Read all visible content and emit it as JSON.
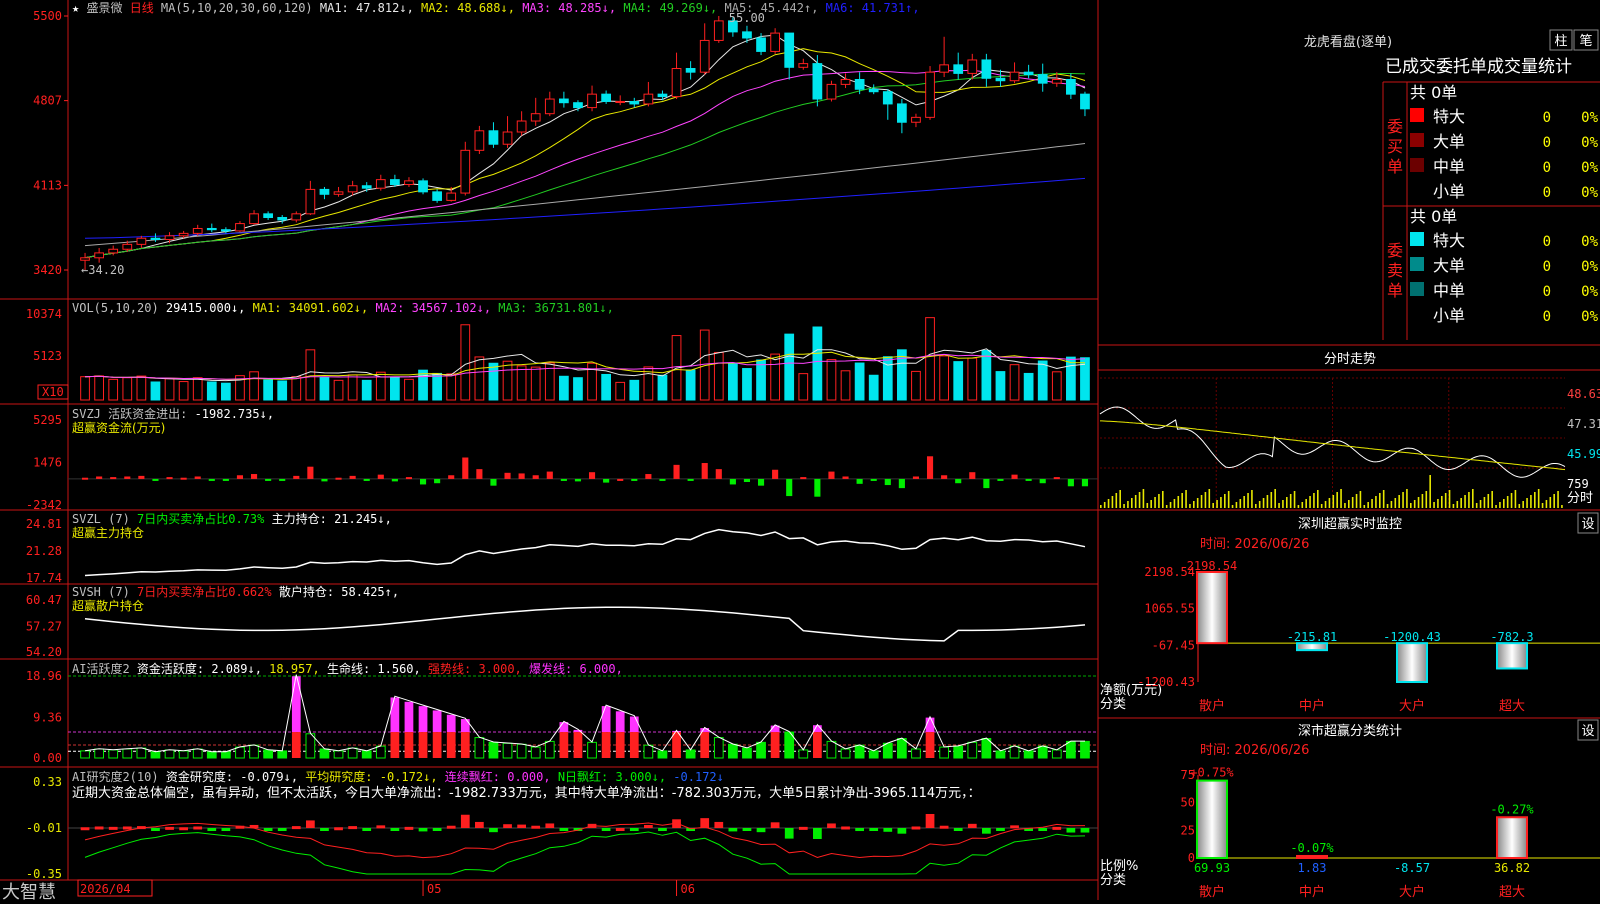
{
  "app": {
    "name": "大智慧"
  },
  "colors": {
    "up": "#ff2020",
    "down": "#00e5ee",
    "bg": "#000000",
    "axis": "#c81414",
    "ma1": "#e8e8e8",
    "ma2": "#e8e800",
    "ma3": "#ff44ff",
    "ma4": "#22cc22",
    "ma5": "#a8a8a8",
    "ma6": "#2020ff",
    "green": "#00ee00",
    "magenta": "#ff33ff"
  },
  "kline": {
    "stock_name": "盛景微",
    "period": "日线",
    "ma_label": "MA(5,10,20,30,60,120)",
    "ma_values": [
      {
        "name": "MA1:",
        "value": "47.812",
        "arrow": "↓"
      },
      {
        "name": "MA2:",
        "value": "48.688",
        "arrow": "↓"
      },
      {
        "name": "MA3:",
        "value": "48.285",
        "arrow": "↓"
      },
      {
        "name": "MA4:",
        "value": "49.269",
        "arrow": "↓"
      },
      {
        "name": "MA5:",
        "value": "45.442",
        "arrow": "↑"
      },
      {
        "name": "MA6:",
        "value": "41.731",
        "arrow": "↑"
      }
    ],
    "high_mark": "55.00",
    "low_mark": "34.20",
    "y_ticks": [
      "5500",
      "4807",
      "4113",
      "3420"
    ]
  },
  "vol": {
    "label": "VOL(5,10,20)",
    "value": "29415.000",
    "value_arrow": "↓",
    "ma": [
      {
        "name": "MA1:",
        "value": "34091.602",
        "arrow": "↓"
      },
      {
        "name": "MA2:",
        "value": "34567.102",
        "arrow": "↓"
      },
      {
        "name": "MA3:",
        "value": "36731.801",
        "arrow": "↓"
      }
    ],
    "y_ticks": [
      "10374",
      "5123"
    ],
    "unit_badge": "X10"
  },
  "svzj": {
    "label": "SVZJ",
    "desc": "活跃资金进出:",
    "value": "-1982.735",
    "arrow": "↓",
    "unit": ",",
    "sub": "超赢资金流(万元)",
    "y_ticks": [
      "5295",
      "1476",
      "-2342"
    ]
  },
  "svzl": {
    "label": "SVZL (7)",
    "desc": "7日内买卖净占比0.73%",
    "hold": "主力持仓:",
    "value": "21.245",
    "arrow": "↓",
    "unit": ",",
    "sub": "超赢主力持仓",
    "y_ticks": [
      "24.81",
      "21.28",
      "17.74"
    ]
  },
  "svsh": {
    "label": "SVSH (7)",
    "desc": "7日内买卖净占比0.662%",
    "hold": "散户持仓:",
    "value": "58.425",
    "arrow": "↑",
    "unit": ",",
    "sub": "超赢散户持仓",
    "y_ticks": [
      "60.47",
      "57.27",
      "54.20"
    ]
  },
  "ai1": {
    "label": "AI活跃度2",
    "desc": "资金活跃度:",
    "value": "2.089",
    "arrow": "↓",
    "v2": "18.957",
    "v2arrow": ",",
    "life": "生命线:",
    "life_val": "1.560,",
    "strong": "强势线:",
    "strong_val": "3.000,",
    "burst": "爆发线:",
    "burst_val": "6.000,",
    "y_ticks": [
      "18.96",
      "9.36",
      "0.00"
    ]
  },
  "ai2": {
    "label": "AI研究度2(10)",
    "desc": "资金研究度:",
    "value": "-0.079",
    "arrow": "↓,",
    "avg": "平均研究度:",
    "avg_val": "-0.172",
    "avg_arrow": "↓,",
    "red": "连续飘红:",
    "red_val": "0.000,",
    "nred": "N日飘红:",
    "nred_val": "3.000",
    "nred_arrow": "↓,",
    "last": "-0.172",
    "last_arrow": "↓",
    "note": "近期大资金总体偏空，虽有异动，但不太活跃，今日大单净流出：-1982.733万元，其中特大单净流出：-782.303万元，大单5日累计净出-3965.114万元，：",
    "y_ticks": [
      "0.33",
      "-0.01",
      "-0.35"
    ]
  },
  "x_axis": {
    "labels": [
      "2026/04",
      "05",
      "06"
    ]
  },
  "right": {
    "lhb_title": "龙虎看盘(逐单)",
    "btn_zhu": "柱",
    "btn_bi": "笔",
    "order_header": "已成交委托单成交量统计",
    "buy_title": "委买单",
    "sell_title": "委卖单",
    "buy_total": "共 0单",
    "sell_total": "共 0单",
    "buy_rows": [
      {
        "label": "特大",
        "count": "0",
        "pct": "0%",
        "color": "#ff0000"
      },
      {
        "label": "大单",
        "count": "0",
        "pct": "0%",
        "color": "#8b0000"
      },
      {
        "label": "中单",
        "count": "0",
        "pct": "0%",
        "color": "#6b0000"
      },
      {
        "label": "小单",
        "count": "0",
        "pct": "0%",
        "color": "#000000"
      }
    ],
    "sell_rows": [
      {
        "label": "特大",
        "count": "0",
        "pct": "0%",
        "color": "#00e5ee"
      },
      {
        "label": "大单",
        "count": "0",
        "pct": "0%",
        "color": "#008b8b"
      },
      {
        "label": "中单",
        "count": "0",
        "pct": "0%",
        "color": "#007070"
      },
      {
        "label": "小单",
        "count": "0",
        "pct": "0%",
        "color": "#000000"
      }
    ],
    "intraday_title": "分时走势",
    "intraday_ticks": [
      "48.63",
      "47.31",
      "45.99"
    ],
    "intraday_vol": "759",
    "intraday_unit": "分时",
    "sz_title": "深圳超赢实时监控",
    "sz_set": "设",
    "sz_time": "时间: 2026/06/26",
    "sz_ticks": [
      "2198.54",
      "1065.55",
      "-67.45",
      "-1200.43"
    ],
    "sz_axis_label": "净额(万元)",
    "sz_axis_label2": "分类",
    "sz_categories": [
      "散户",
      "中户",
      "大户",
      "超大"
    ],
    "sz_values": [
      2198.54,
      -215.81,
      -1200.43,
      -782.3
    ],
    "sz_value_labels": [
      "2198.54",
      "-215.81",
      "-1200.43",
      "-782.3"
    ],
    "cls_title": "深市超赢分类统计",
    "cls_set": "设",
    "cls_time": "时间: 2026/06/26",
    "cls_ticks": [
      "75",
      "50",
      "25",
      "0"
    ],
    "cls_axis_label": "比例%",
    "cls_axis_label2": "分类",
    "cls_categories": [
      "散户",
      "中户",
      "大户",
      "超大"
    ],
    "cls_pct_labels": [
      "+0.75%",
      "-0.07%",
      "",
      "-0.27%"
    ],
    "cls_values": [
      69.93,
      1.83,
      -8.57,
      36.82
    ],
    "cls_value_labels": [
      "69.93",
      "1.83",
      "-8.57",
      "36.82"
    ]
  },
  "chart_data": {
    "type": "candlestick",
    "title": "盛景微 日线",
    "ylim": [
      34.2,
      55.0
    ],
    "candles": [
      [
        35.0,
        35.2,
        34.2,
        35.6
      ],
      [
        35.2,
        35.6,
        34.8,
        36.0
      ],
      [
        35.6,
        35.9,
        35.4,
        36.2
      ],
      [
        35.9,
        36.3,
        35.7,
        36.6
      ],
      [
        36.3,
        36.8,
        36.0,
        37.0
      ],
      [
        36.8,
        36.7,
        36.5,
        37.2
      ],
      [
        36.7,
        37.0,
        36.4,
        37.3
      ],
      [
        37.0,
        37.2,
        36.8,
        37.4
      ],
      [
        37.2,
        37.6,
        37.0,
        37.9
      ],
      [
        37.6,
        37.5,
        37.3,
        38.0
      ],
      [
        37.5,
        37.4,
        37.2,
        37.7
      ],
      [
        37.4,
        38.0,
        37.3,
        38.2
      ],
      [
        38.0,
        38.8,
        37.9,
        39.1
      ],
      [
        38.8,
        38.5,
        38.3,
        39.0
      ],
      [
        38.5,
        38.3,
        38.0,
        38.7
      ],
      [
        38.3,
        38.8,
        38.1,
        39.0
      ],
      [
        38.8,
        40.8,
        38.7,
        41.5
      ],
      [
        40.8,
        40.4,
        40.0,
        41.0
      ],
      [
        40.4,
        40.6,
        40.2,
        41.0
      ],
      [
        40.6,
        41.1,
        40.3,
        41.5
      ],
      [
        41.1,
        40.9,
        40.6,
        41.4
      ],
      [
        40.9,
        41.6,
        40.7,
        42.0
      ],
      [
        41.6,
        41.2,
        41.0,
        42.0
      ],
      [
        41.2,
        41.5,
        41.0,
        41.8
      ],
      [
        41.5,
        40.6,
        40.4,
        41.7
      ],
      [
        40.6,
        39.9,
        39.7,
        40.8
      ],
      [
        39.9,
        40.5,
        39.8,
        41.0
      ],
      [
        40.5,
        44.0,
        40.3,
        44.7
      ],
      [
        44.0,
        45.6,
        43.7,
        46.0
      ],
      [
        45.6,
        44.5,
        44.2,
        46.3
      ],
      [
        44.5,
        45.5,
        44.2,
        46.8
      ],
      [
        45.5,
        46.4,
        45.2,
        47.2
      ],
      [
        46.4,
        47.0,
        46.0,
        48.3
      ],
      [
        47.0,
        48.2,
        46.8,
        48.8
      ],
      [
        48.2,
        47.9,
        47.5,
        48.8
      ],
      [
        47.9,
        47.5,
        47.2,
        48.1
      ],
      [
        47.5,
        48.6,
        47.2,
        49.3
      ],
      [
        48.6,
        48.0,
        47.8,
        48.9
      ],
      [
        48.0,
        48.0,
        47.7,
        48.5
      ],
      [
        48.0,
        47.8,
        47.5,
        48.3
      ],
      [
        47.8,
        48.6,
        47.6,
        49.6
      ],
      [
        48.6,
        48.4,
        48.1,
        48.9
      ],
      [
        48.4,
        50.7,
        48.2,
        52.0
      ],
      [
        50.7,
        50.4,
        49.8,
        51.3
      ],
      [
        50.4,
        53.0,
        50.2,
        54.4
      ],
      [
        53.0,
        54.6,
        52.8,
        55.0
      ],
      [
        54.6,
        53.7,
        53.3,
        54.9
      ],
      [
        53.7,
        53.2,
        52.8,
        54.2
      ],
      [
        53.2,
        52.1,
        51.8,
        53.6
      ],
      [
        52.1,
        53.6,
        51.9,
        54.0
      ],
      [
        53.6,
        50.8,
        49.8,
        53.0
      ],
      [
        50.8,
        51.1,
        50.6,
        51.5
      ],
      [
        51.1,
        48.2,
        47.6,
        51.8
      ],
      [
        48.2,
        49.4,
        48.0,
        49.7
      ],
      [
        49.4,
        49.8,
        49.1,
        50.3
      ],
      [
        49.8,
        49.0,
        48.6,
        50.4
      ],
      [
        49.0,
        48.8,
        48.6,
        49.4
      ],
      [
        48.8,
        47.8,
        46.5,
        49.0
      ],
      [
        47.8,
        46.3,
        45.4,
        48.2
      ],
      [
        46.3,
        46.7,
        45.9,
        47.0
      ],
      [
        46.7,
        50.4,
        46.5,
        50.9
      ],
      [
        50.4,
        51.0,
        50.0,
        53.3
      ],
      [
        51.0,
        50.3,
        49.8,
        52.0
      ],
      [
        50.3,
        51.4,
        49.8,
        51.9
      ],
      [
        51.4,
        49.9,
        49.2,
        51.9
      ],
      [
        49.9,
        49.7,
        49.2,
        50.6
      ],
      [
        49.7,
        50.4,
        49.5,
        51.2
      ],
      [
        50.4,
        50.2,
        49.9,
        51.0
      ],
      [
        50.2,
        49.5,
        48.8,
        51.1
      ],
      [
        49.5,
        49.8,
        49.2,
        50.4
      ],
      [
        49.8,
        48.6,
        48.2,
        50.3
      ],
      [
        48.6,
        47.4,
        46.8,
        48.8
      ]
    ]
  }
}
